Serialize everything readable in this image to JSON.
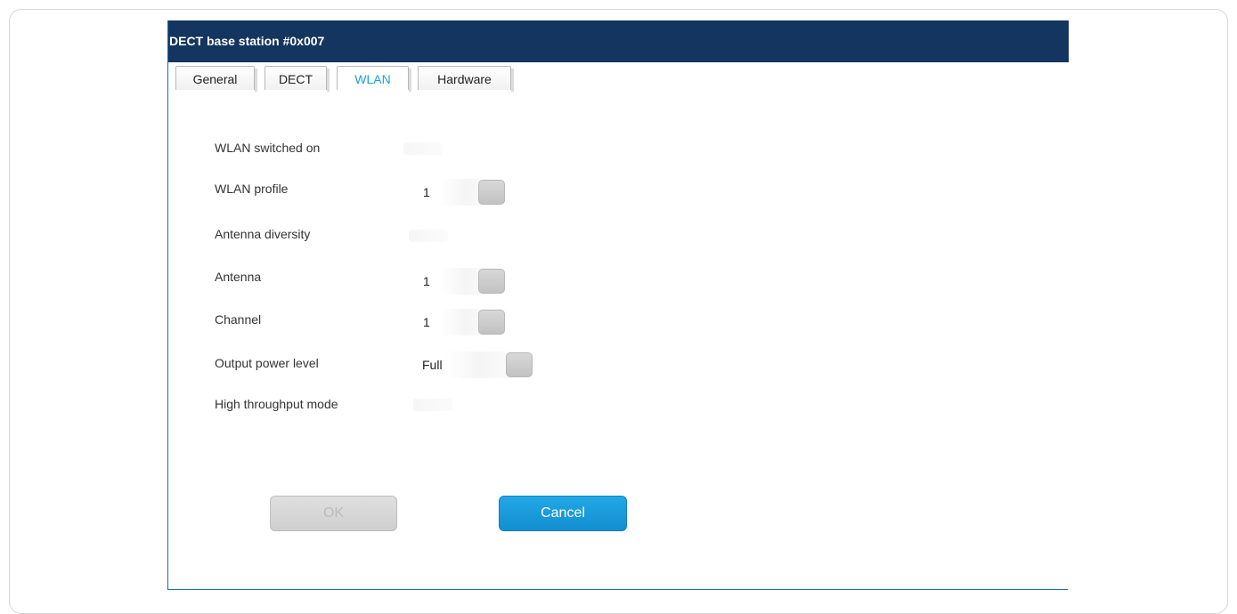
{
  "dialog": {
    "title": "DECT base station #0x007"
  },
  "tabs": [
    {
      "label": "General",
      "active": false
    },
    {
      "label": "DECT",
      "active": false
    },
    {
      "label": "WLAN",
      "active": true
    },
    {
      "label": "Hardware",
      "active": false
    }
  ],
  "fields": {
    "wlan_switched_on": {
      "label": "WLAN switched on"
    },
    "wlan_profile": {
      "label": "WLAN profile",
      "value": "1"
    },
    "antenna_diversity": {
      "label": "Antenna diversity"
    },
    "antenna": {
      "label": "Antenna",
      "value": "1"
    },
    "channel": {
      "label": "Channel",
      "value": "1"
    },
    "output_power_level": {
      "label": "Output power level",
      "value": "Full"
    },
    "high_throughput_mode": {
      "label": "High throughput mode"
    }
  },
  "buttons": {
    "ok_label": "OK",
    "cancel_label": "Cancel"
  },
  "colors": {
    "title_bar": "#13355f",
    "accent": "#1a9fd9",
    "cancel_button": "#1a9fd9"
  },
  "icons": {
    "dropdown": "dropdown-button-icon"
  }
}
